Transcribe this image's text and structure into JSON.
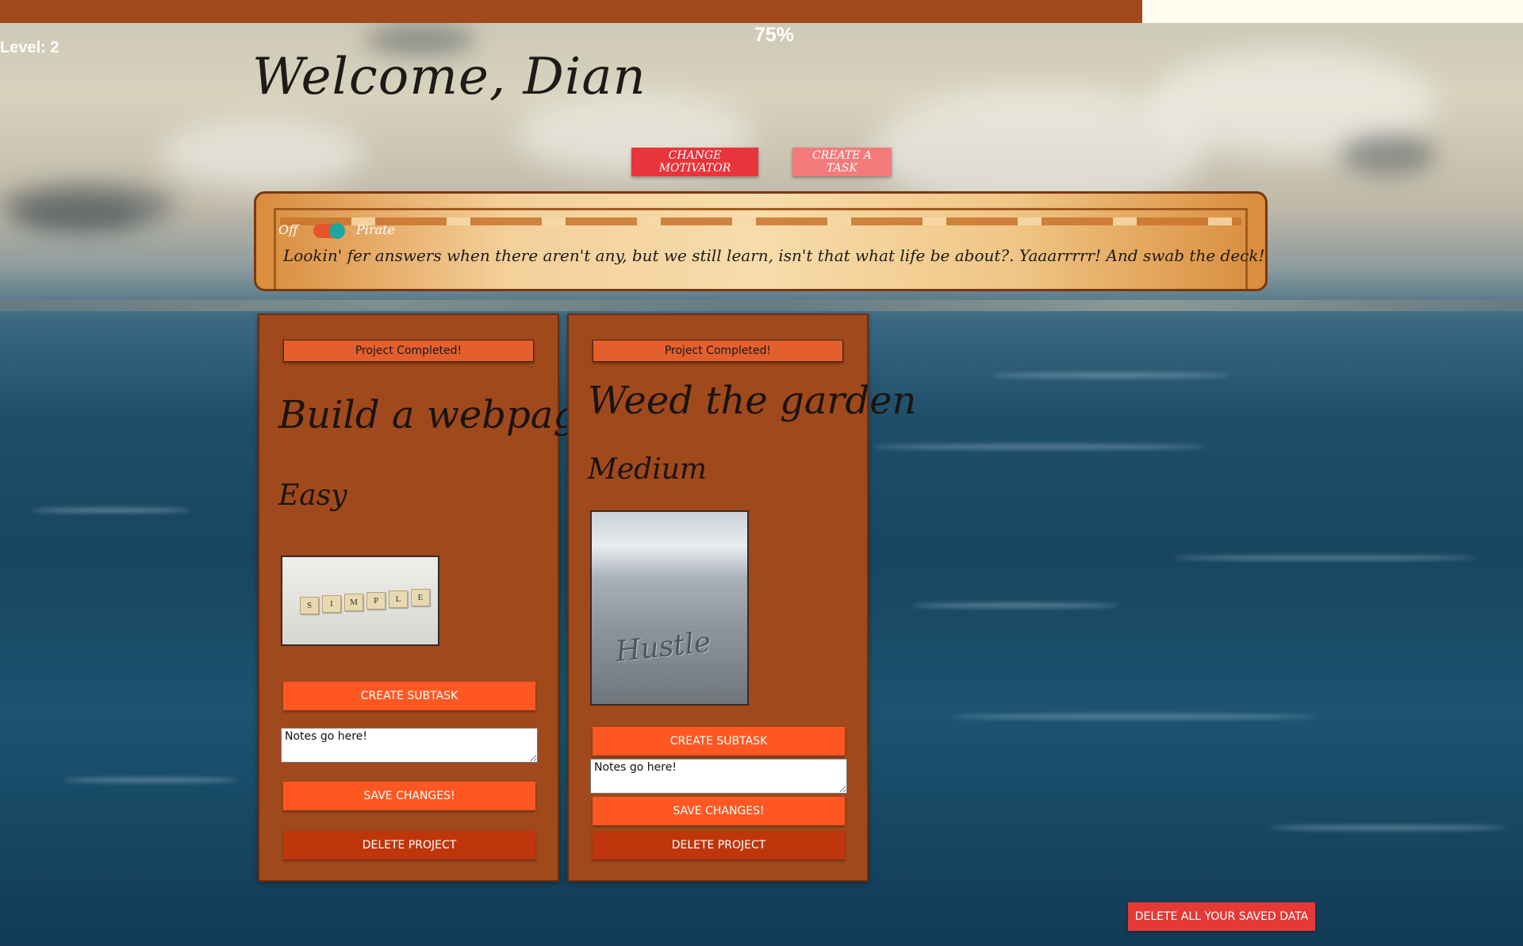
{
  "progress": {
    "percent_label": "75%",
    "fraction": 0.75
  },
  "level_label": "Level: 2",
  "welcome": "Welcome, Dian",
  "buttons": {
    "change_motivator": "CHANGE MOTIVATOR",
    "create_task": "CREATE A TASK"
  },
  "motivator": {
    "toggle_off_label": "Off",
    "toggle_on_label": "Pirate",
    "toggle_state": "on",
    "quote": "Lookin' fer answers when there aren't any, but we still learn, isn't that what life be about?. Yaaarrrrr! And swab the deck! -RM o' BTS"
  },
  "projects": [
    {
      "completed_label": "Project Completed!",
      "title": "Build a webpage",
      "difficulty": "Easy",
      "image_letters": [
        "S",
        "I",
        "M",
        "P",
        "L",
        "E"
      ],
      "create_subtask": "CREATE SUBTASK",
      "notes": "Notes go here!",
      "save": "SAVE CHANGES!",
      "delete": "DELETE PROJECT"
    },
    {
      "completed_label": "Project Completed!",
      "title": "Weed the garden",
      "difficulty": "Medium",
      "image_text": "Hustle",
      "create_subtask": "CREATE SUBTASK",
      "notes": "Notes go here!",
      "save": "SAVE CHANGES!",
      "delete": "DELETE PROJECT"
    }
  ],
  "delete_all": "DELETE ALL YOUR SAVED DATA",
  "colors": {
    "card": "#a0491c",
    "progress_fill": "#a0491c",
    "primary_button": "#ff5722",
    "danger_button": "#bf360c",
    "motivator_button": "#e8343a",
    "create_task_button": "#f37b7b",
    "toggle_knob": "#1fa6a0"
  }
}
